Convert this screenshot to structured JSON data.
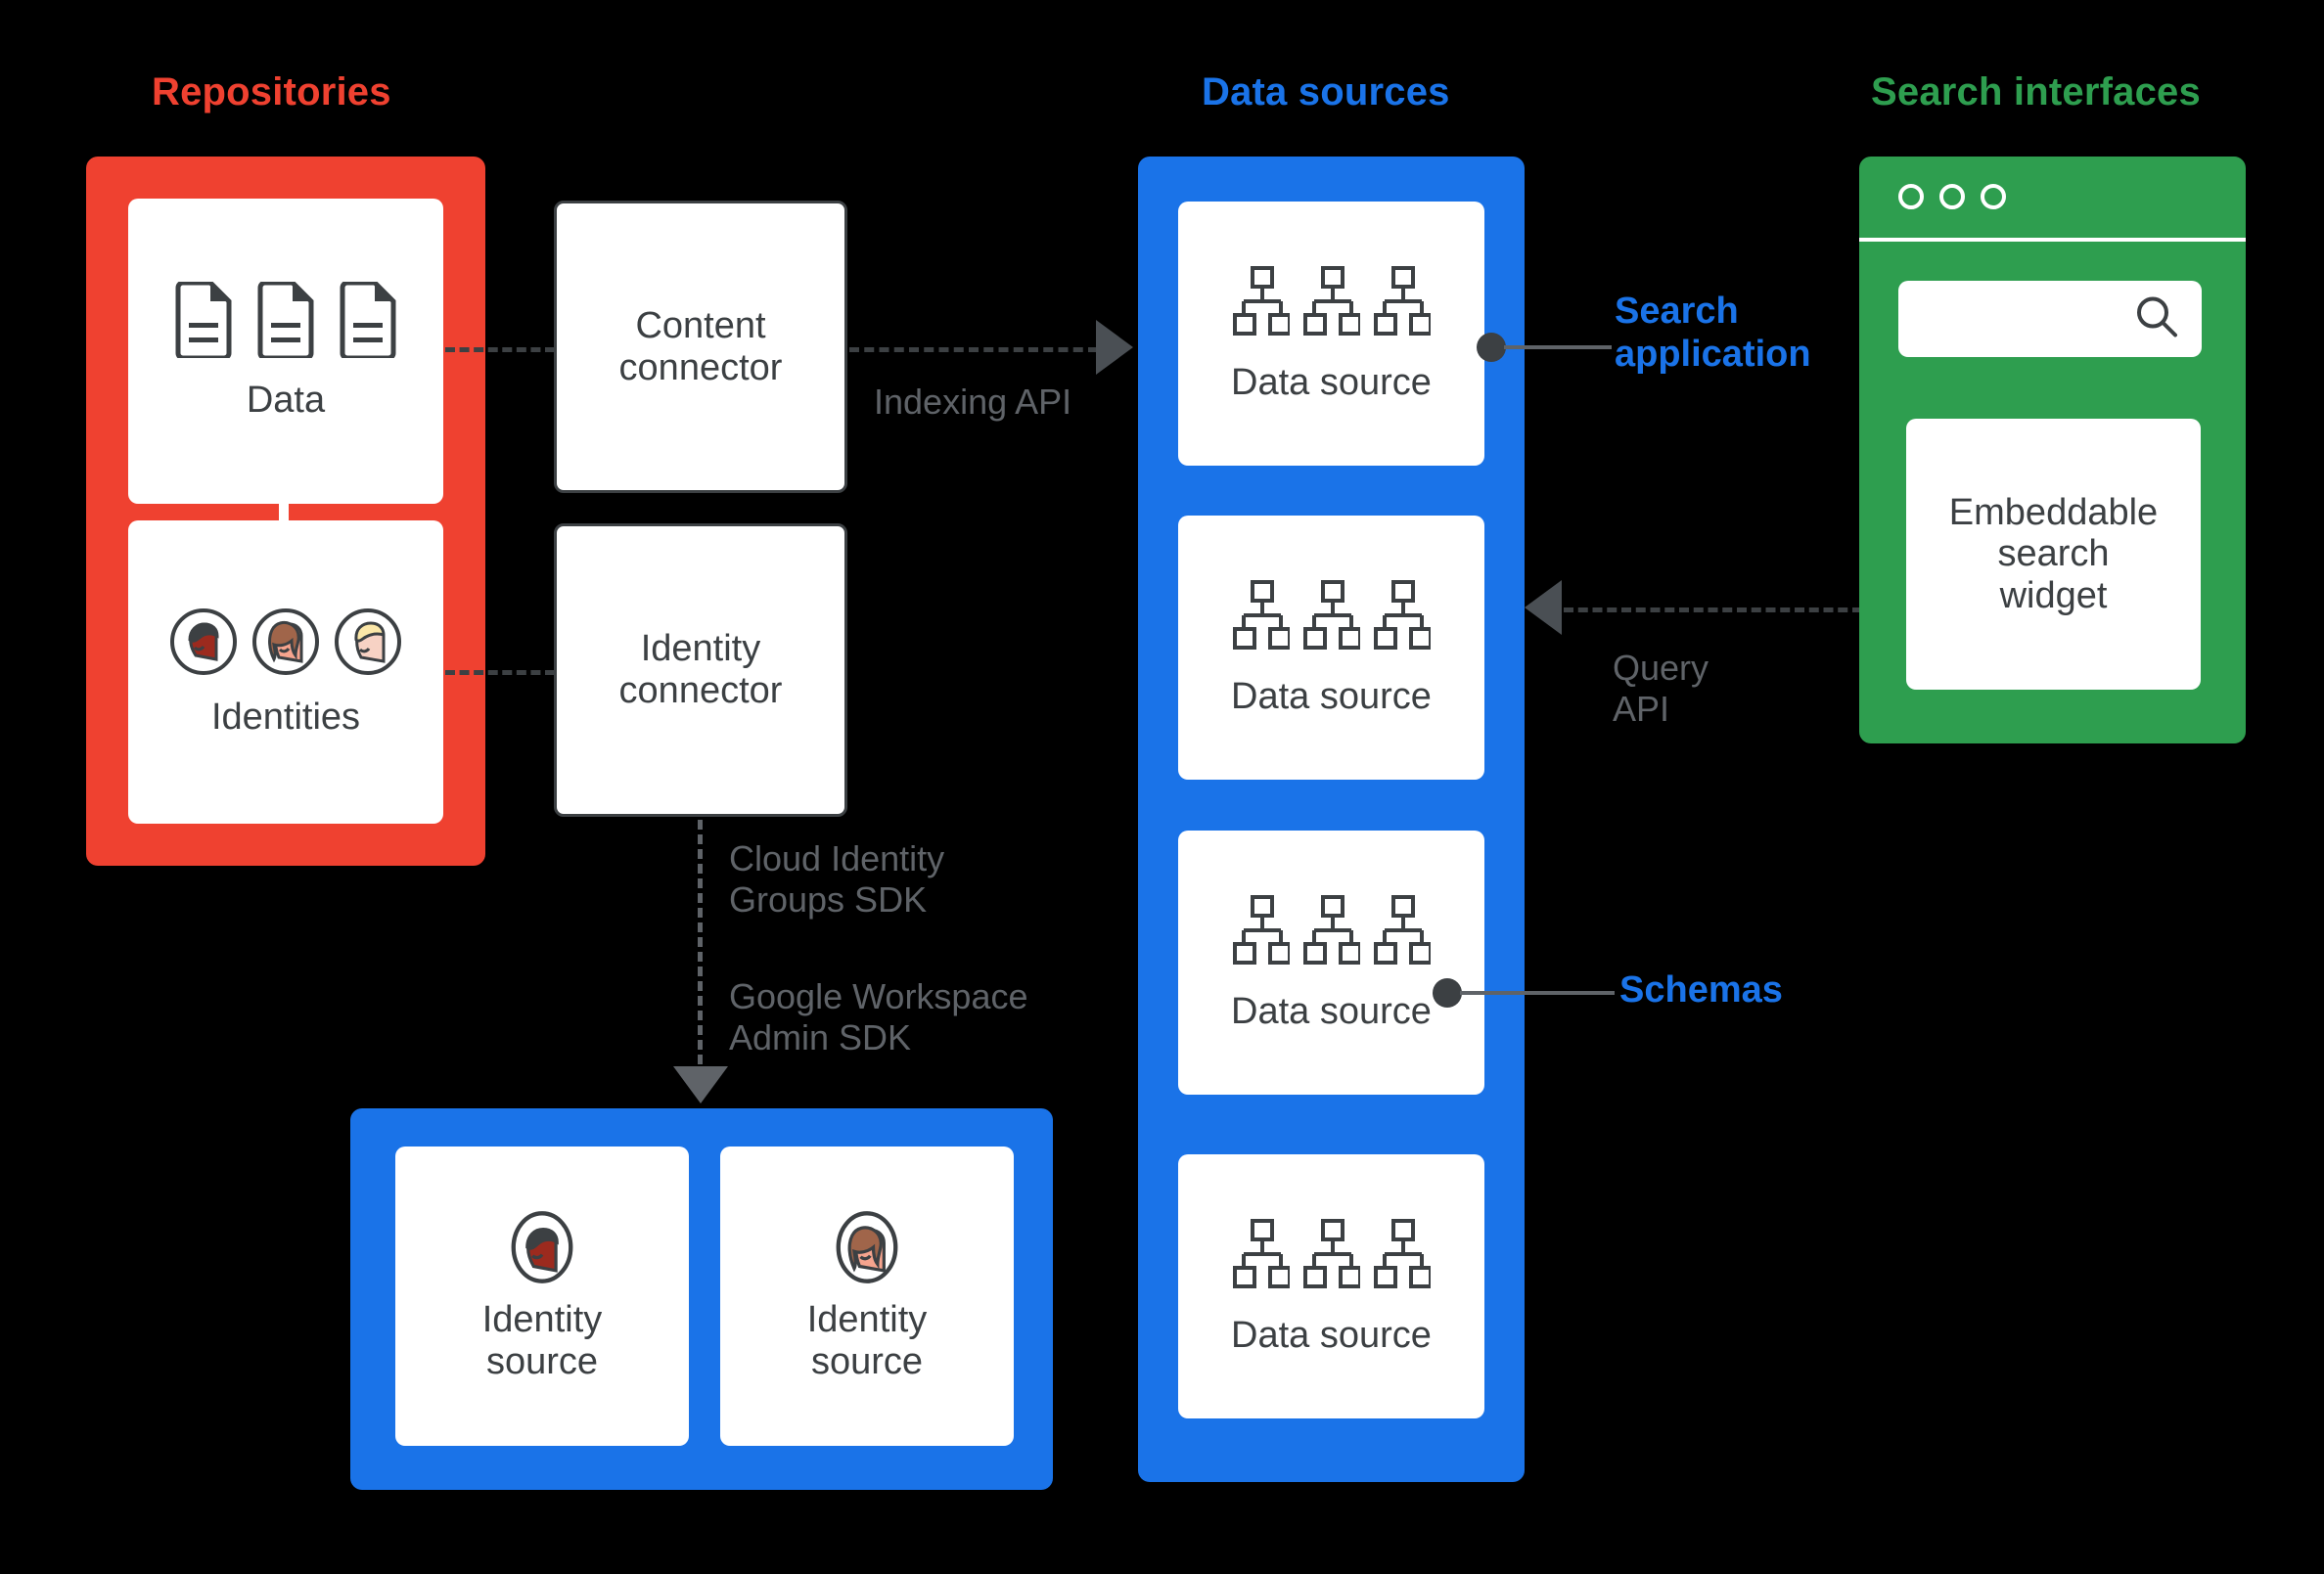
{
  "sections": {
    "repositories": {
      "title": "Repositories",
      "color": "#ef4130"
    },
    "data_sources": {
      "title": "Data sources",
      "color": "#1a73e8"
    },
    "search_interfaces": {
      "title": "Search interfaces",
      "color": "#2e9e4f"
    }
  },
  "repositories": {
    "cards": [
      {
        "label": "Data",
        "icon": "document-icon"
      },
      {
        "label": "Identities",
        "icon": "person-avatar-icon"
      }
    ]
  },
  "connectors": [
    {
      "label": "Content\nconnector",
      "name": "content-connector"
    },
    {
      "label": "Identity\nconnector",
      "name": "identity-connector"
    }
  ],
  "data_sources": {
    "cards": [
      {
        "label": "Data source",
        "icon": "hierarchy-icon"
      },
      {
        "label": "Data source",
        "icon": "hierarchy-icon"
      },
      {
        "label": "Data source",
        "icon": "hierarchy-icon"
      },
      {
        "label": "Data source",
        "icon": "hierarchy-icon"
      }
    ]
  },
  "identity_sources": {
    "cards": [
      {
        "label": "Identity\nsource",
        "icon": "person-avatar-icon"
      },
      {
        "label": "Identity\nsource",
        "icon": "person-avatar-icon"
      }
    ]
  },
  "search_interface": {
    "window_dots": 3,
    "search_placeholder": "",
    "search_icon": "search-icon",
    "widget_label": "Embeddable\nsearch\nwidget"
  },
  "edges": {
    "indexing_api": "Indexing API",
    "query_api": "Query\nAPI",
    "cloud_identity_sdk": "Cloud Identity\nGroups SDK",
    "workspace_admin_sdk": "Google Workspace\nAdmin SDK"
  },
  "callouts": {
    "search_application": "Search\napplication",
    "schemas": "Schemas"
  },
  "colors": {
    "red": "#ef4130",
    "blue": "#1a73e8",
    "green": "#2e9e4f",
    "dark": "#3c4043",
    "gray": "#5f6368",
    "background": "#000000"
  }
}
